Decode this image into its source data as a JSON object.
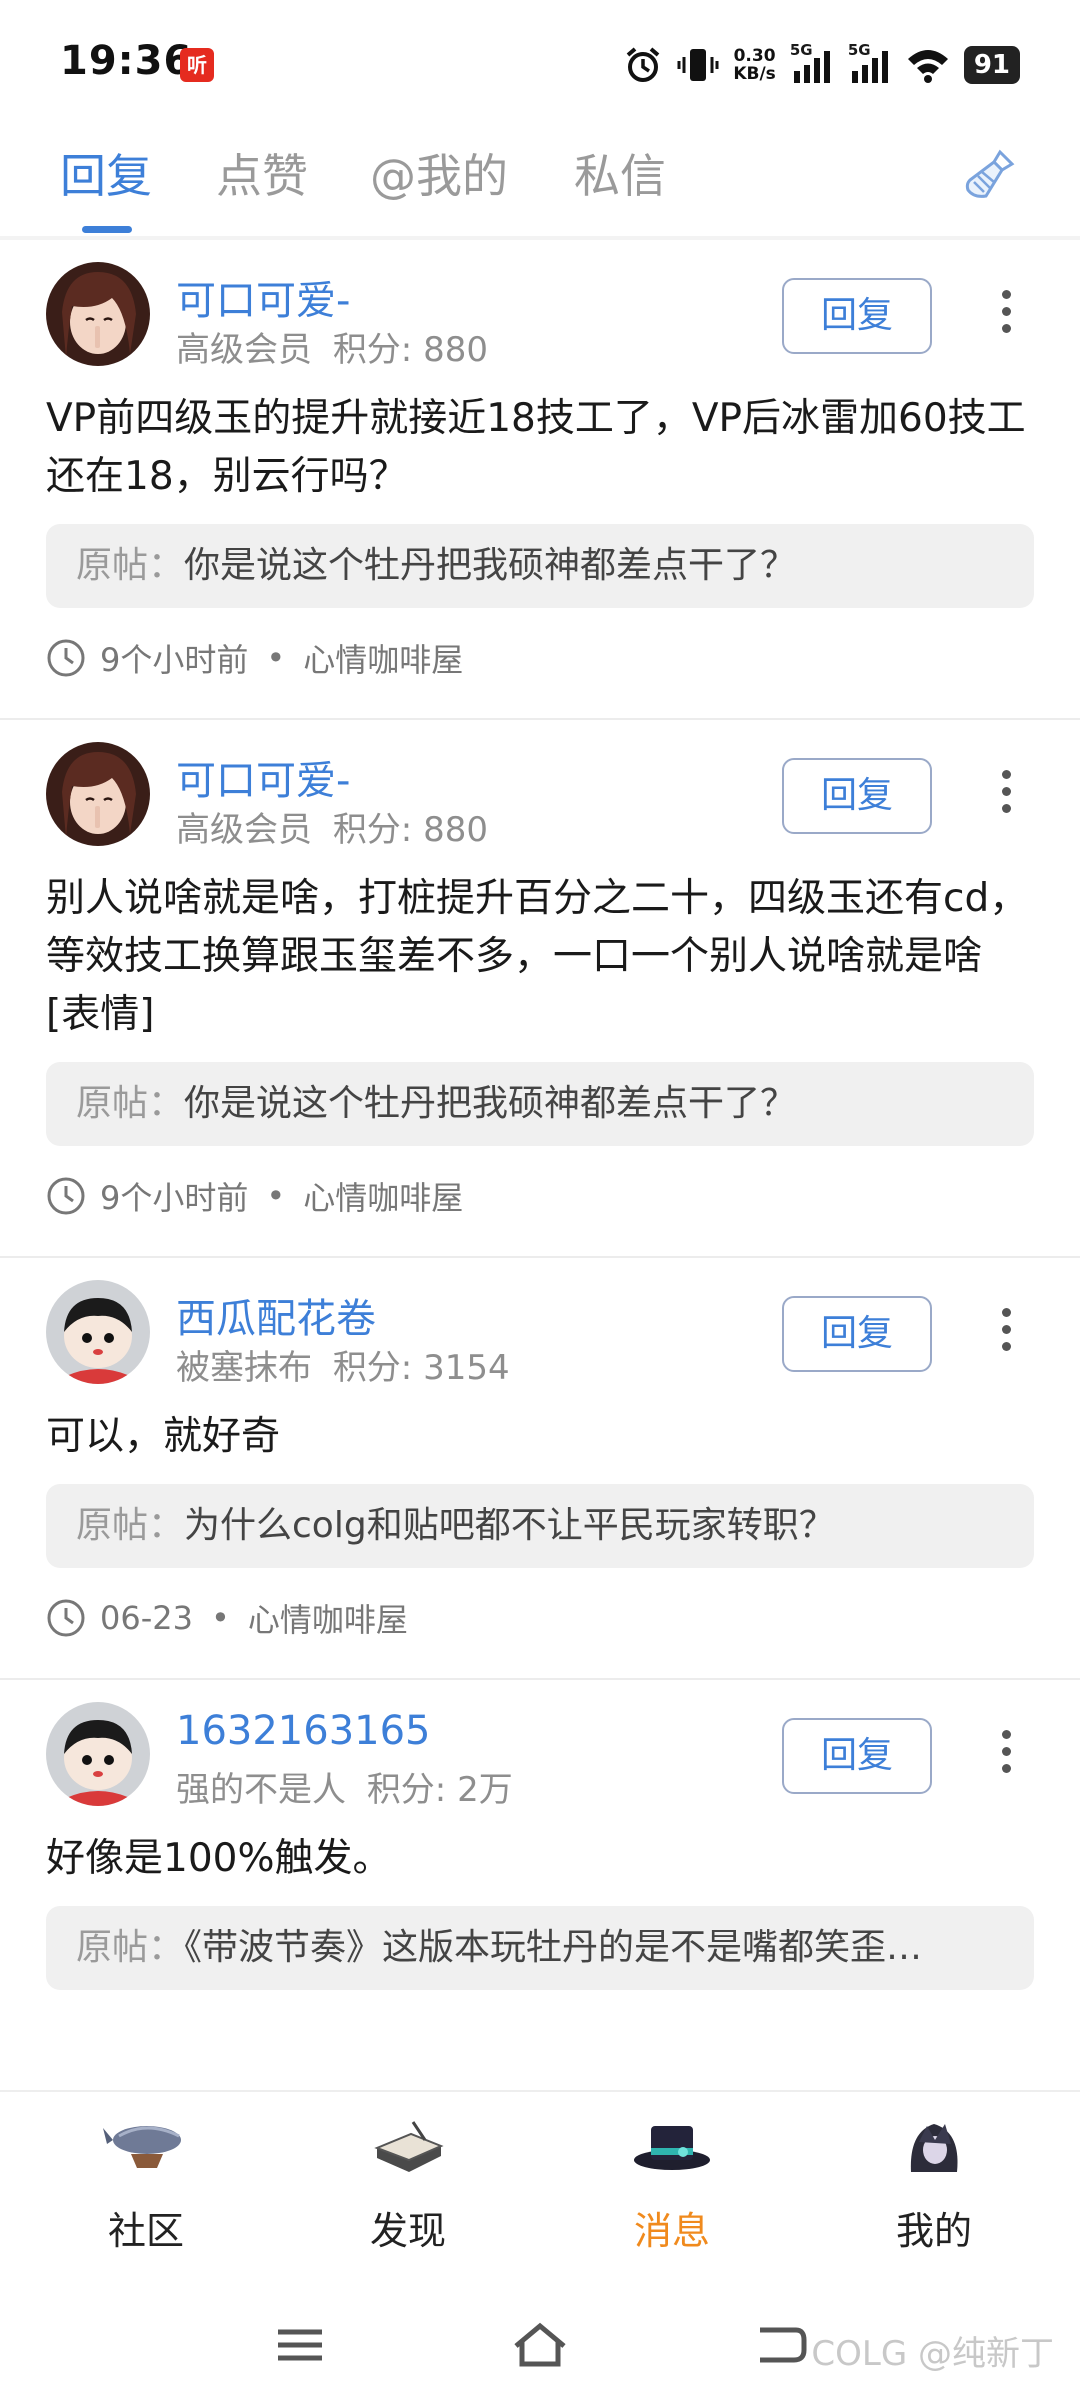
{
  "status_bar": {
    "time": "19:36",
    "app_icon_label": "听",
    "speed_value": "0.30",
    "speed_unit": "KB/s",
    "signal_1": "5G",
    "signal_2": "5G",
    "battery": "91"
  },
  "tabs": [
    {
      "label": "回复",
      "active": true
    },
    {
      "label": "点赞",
      "active": false
    },
    {
      "label": "@我的",
      "active": false
    },
    {
      "label": "私信",
      "active": false
    }
  ],
  "items": [
    {
      "username": "可口可爱-",
      "level": "高级会员",
      "points": "积分: 880",
      "reply_label": "回复",
      "content": "VP前四级玉的提升就接近18技工了，VP后冰雷加60技工还在18，别云行吗？",
      "quote_label": "原帖：",
      "quote_text": "你是说这个牡丹把我硕神都差点干了？",
      "time": "9个小时前",
      "forum": "心情咖啡屋"
    },
    {
      "username": "可口可爱-",
      "level": "高级会员",
      "points": "积分: 880",
      "reply_label": "回复",
      "content": "别人说啥就是啥，打桩提升百分之二十，四级玉还有cd，等效技工换算跟玉玺差不多，一口一个别人说啥就是啥[表情]",
      "quote_label": "原帖：",
      "quote_text": "你是说这个牡丹把我硕神都差点干了？",
      "time": "9个小时前",
      "forum": "心情咖啡屋"
    },
    {
      "username": "西瓜配花卷",
      "level": "被塞抹布",
      "points": "积分: 3154",
      "reply_label": "回复",
      "content": "可以，就好奇",
      "quote_label": "原帖：",
      "quote_text": "为什么colg和贴吧都不让平民玩家转职？",
      "time": "06-23",
      "forum": "心情咖啡屋"
    },
    {
      "username": "1632163165",
      "level": "强的不是人",
      "points": "积分: 2万",
      "reply_label": "回复",
      "content": "好像是100%触发。",
      "quote_label": "原帖：",
      "quote_text": "《带波节奏》这版本玩牡丹的是不是嘴都笑歪…",
      "time": "",
      "forum": ""
    }
  ],
  "bottom_nav": [
    {
      "label": "社区",
      "active": false
    },
    {
      "label": "发现",
      "active": false
    },
    {
      "label": "消息",
      "active": true
    },
    {
      "label": "我的",
      "active": false
    }
  ],
  "watermark": "COLG @纯新丁",
  "colors": {
    "accent": "#3d7fd8",
    "active_nav": "#f08a1d"
  }
}
